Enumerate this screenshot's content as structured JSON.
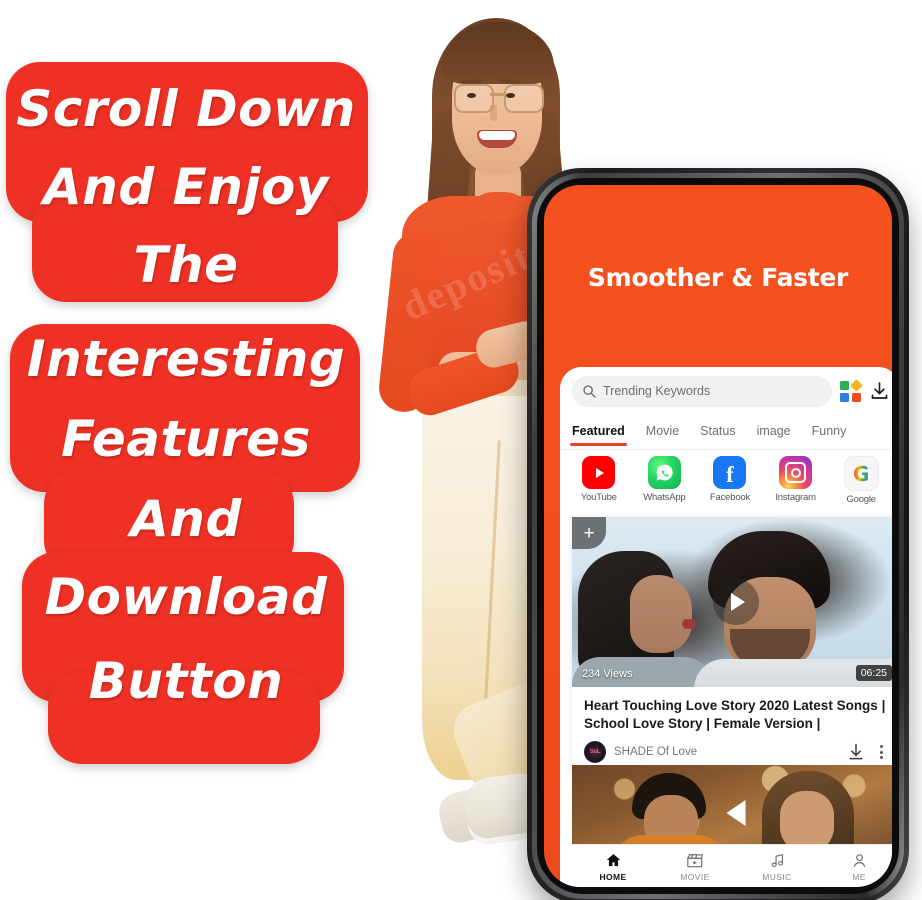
{
  "callout": {
    "lines": [
      "Scroll Down",
      "And Enjoy",
      "The",
      "Interesting",
      "Features",
      "And",
      "Download",
      "Button"
    ],
    "background_color": "#ee3124",
    "text_color": "#ffffff"
  },
  "person": {
    "description": "woman-with-glasses-pointing",
    "watermark": "depositphotos"
  },
  "phone": {
    "screen_background_color": "#f4511e",
    "headline": "Smoother & Faster",
    "search": {
      "placeholder": "Trending Keywords",
      "search_icon": "search-icon",
      "grid_icon": "grid-apps-icon",
      "download_icon": "download-icon"
    },
    "tabs": [
      {
        "label": "Featured",
        "active": true
      },
      {
        "label": "Movie",
        "active": false
      },
      {
        "label": "Status",
        "active": false
      },
      {
        "label": "image",
        "active": false
      },
      {
        "label": "Funny",
        "active": false
      }
    ],
    "tab_indicator_color": "#e8402a",
    "apps": [
      {
        "label": "YouTube",
        "icon": "youtube-icon"
      },
      {
        "label": "WhatsApp",
        "icon": "whatsapp-icon"
      },
      {
        "label": "Facebook",
        "icon": "facebook-icon"
      },
      {
        "label": "Instagram",
        "icon": "instagram-icon"
      },
      {
        "label": "Google",
        "icon": "google-icon"
      }
    ],
    "video_card": {
      "add_label": "+",
      "views": "234 Views",
      "duration": "06:25",
      "title_line1": "Heart Touching Love Story 2020 Latest Songs |",
      "title_line2": "School Love Story | Female Version |",
      "channel": "SHADE Of Love",
      "avatar_text": "SoL",
      "download_icon": "download-icon",
      "more_icon": "more-vertical-icon",
      "play_icon": "play-icon"
    },
    "video_card_2": {
      "play_icon": "play-icon"
    },
    "bottom_nav": [
      {
        "label": "HOME",
        "icon": "home-icon",
        "active": true
      },
      {
        "label": "MOVIE",
        "icon": "clapperboard-icon",
        "active": false
      },
      {
        "label": "MUSIC",
        "icon": "music-note-icon",
        "active": false
      },
      {
        "label": "ME",
        "icon": "person-icon",
        "active": false
      }
    ]
  }
}
